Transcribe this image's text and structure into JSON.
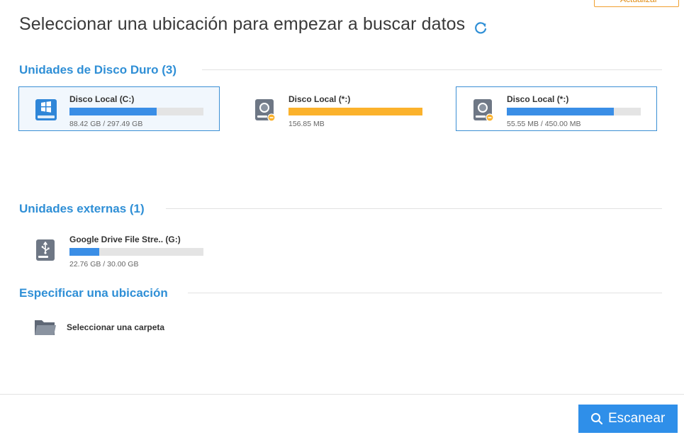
{
  "top_button": {
    "label": "Actualizar"
  },
  "page": {
    "title": "Seleccionar una ubicación para empezar a buscar datos"
  },
  "sections": {
    "hard_drives": {
      "title": "Unidades de Disco Duro (3)",
      "drives": [
        {
          "name": "Disco Local (C:)",
          "size": "88.42 GB / 297.49 GB",
          "usage": 0.65,
          "icon": "windows-drive-icon",
          "color": "#3a8ee6"
        },
        {
          "name": "Disco Local (*:)",
          "size": "156.85 MB",
          "usage": 1.0,
          "icon": "hard-disk-icon",
          "color": "#fbb22c"
        },
        {
          "name": "Disco Local (*:)",
          "size": "55.55 MB / 450.00 MB",
          "usage": 0.8,
          "icon": "hard-disk-icon",
          "color": "#3a8ee6"
        }
      ]
    },
    "external": {
      "title": "Unidades externas (1)",
      "drives": [
        {
          "name": "Google Drive File Stre.. (G:)",
          "size": "22.76 GB / 30.00 GB",
          "usage": 0.22,
          "icon": "usb-drive-icon",
          "color": "#3a8ee6"
        }
      ]
    },
    "location": {
      "title": "Especificar una ubicación",
      "select_folder": "Seleccionar una carpeta"
    }
  },
  "footer": {
    "scan_label": "Escanear"
  },
  "colors": {
    "accent": "#2f8fe9",
    "section_title": "#2f8fd6",
    "warning_bar": "#fbb22c"
  }
}
